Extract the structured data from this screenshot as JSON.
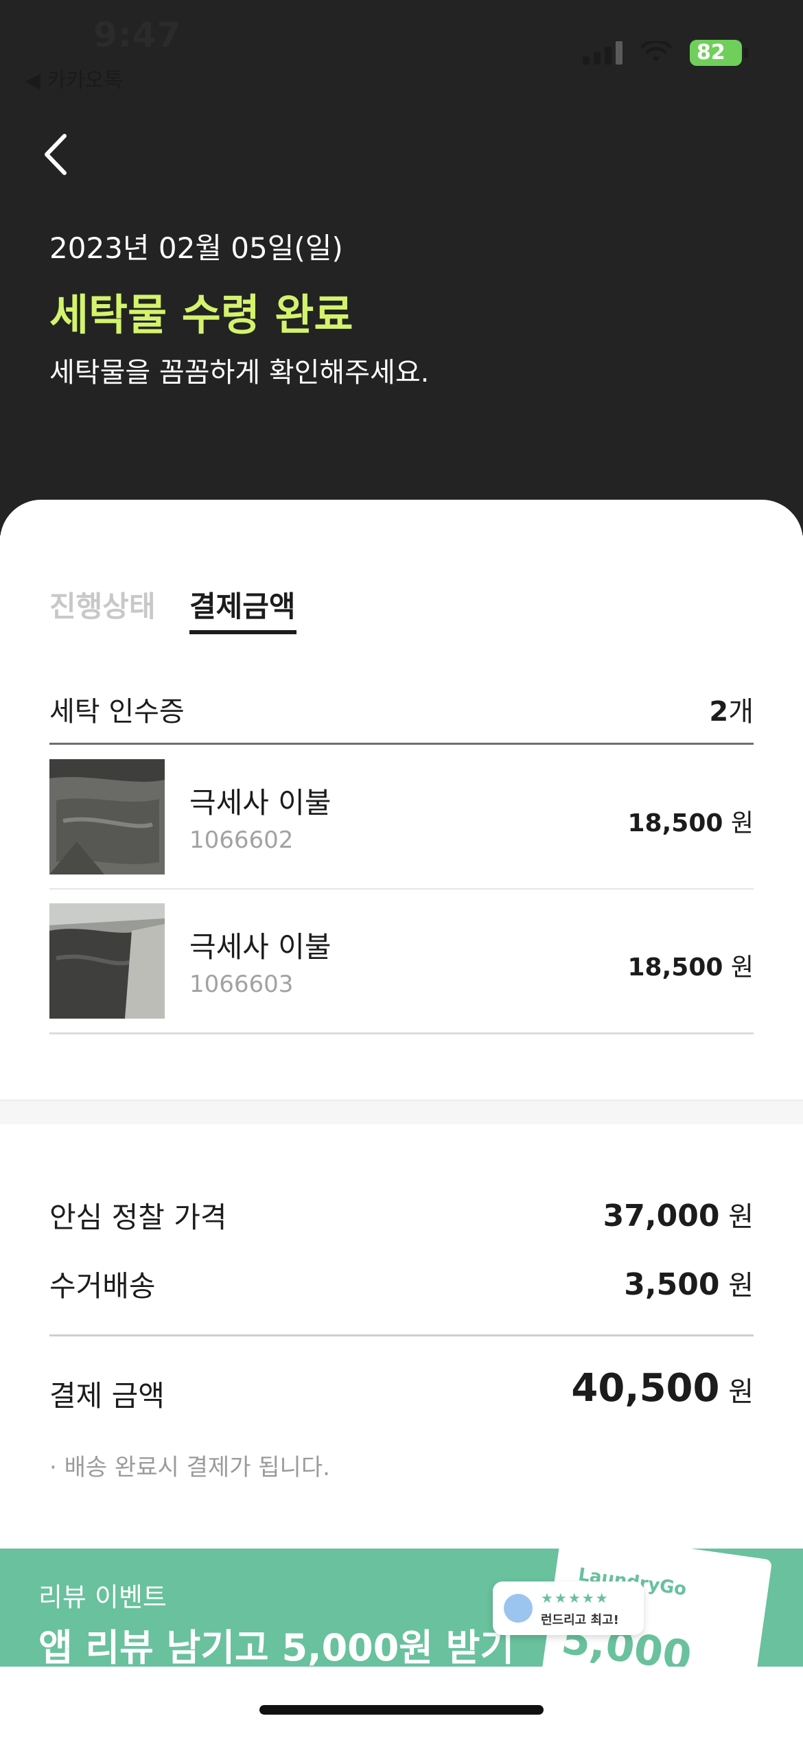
{
  "status_bar": {
    "time": "9:47",
    "back_app": "◀ 카카오톡",
    "battery": "82"
  },
  "header": {
    "date": "2023년 02월 05일(일)",
    "title": "세탁물 수령 완료",
    "subtitle": "세탁물을 꼼꼼하게 확인해주세요."
  },
  "tabs": [
    {
      "label": "진행상태",
      "active": false
    },
    {
      "label": "결제금액",
      "active": true
    }
  ],
  "receipt": {
    "title": "세탁 인수증",
    "count": "2",
    "count_unit": "개",
    "items": [
      {
        "name": "극세사 이불",
        "code": "1066602",
        "price": "18,500",
        "currency": "원"
      },
      {
        "name": "극세사 이불",
        "code": "1066603",
        "price": "18,500",
        "currency": "원"
      }
    ]
  },
  "summary": {
    "rows": [
      {
        "label": "안심 정찰 가격",
        "value": "37,000",
        "unit": "원"
      },
      {
        "label": "수거배송",
        "value": "3,500",
        "unit": "원"
      }
    ],
    "total_label": "결제 금액",
    "total_value": "40,500",
    "total_unit": "원",
    "note": "· 배송 완료시 결제가 됩니다."
  },
  "banner": {
    "kicker": "리뷰 이벤트",
    "title": "앱 리뷰 남기고 5,000원 받기",
    "card_logo": "LaundryGo",
    "card_amount": "5,000",
    "bubble_stars": "★★★★★",
    "bubble_text": "런드리고 최고!",
    "color": "#69c19d"
  },
  "colors": {
    "header_bg": "#232323",
    "accent": "#d4f36d"
  }
}
